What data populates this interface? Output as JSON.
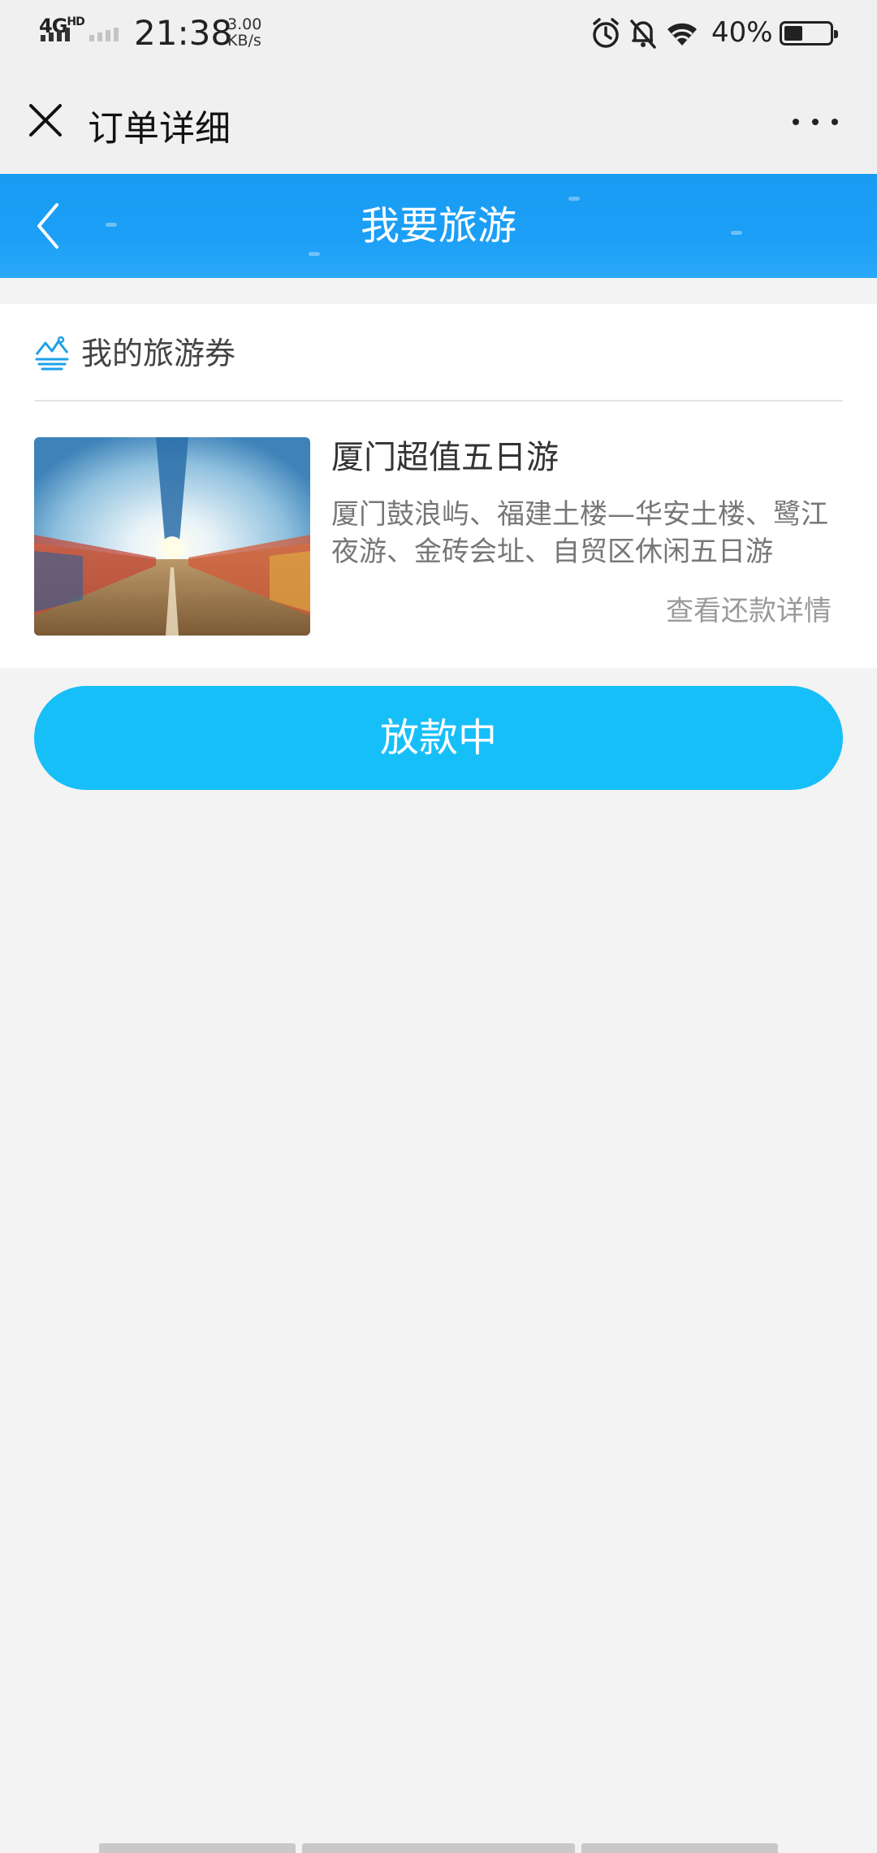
{
  "status_bar": {
    "network_type": "4G",
    "network_sup": "HD",
    "time": "21:38",
    "net_speed_value": "3.00",
    "net_speed_unit": "KB/s",
    "battery_percent": "40%",
    "battery_level": 0.4,
    "icons": [
      "signal-icon",
      "alarm-icon",
      "mute-icon",
      "wifi-icon",
      "battery-icon"
    ]
  },
  "nav_bar": {
    "title": "订单详细",
    "close_icon": "close-icon",
    "more_icon": "more-icon"
  },
  "header": {
    "title": "我要旅游",
    "back_icon": "chevron-left-icon",
    "color": "#1a9cf3"
  },
  "voucher_card": {
    "section_label": "我的旅游券",
    "section_icon": "mountain-icon",
    "product": {
      "title": "厦门超值五日游",
      "description": "厦门鼓浪屿、福建土楼—华安土楼、鹭江夜游、金砖会址、自贸区休闲五日游",
      "detail_link": "查看还款详情"
    }
  },
  "action_button": {
    "label": "放款中",
    "color": "#17bff8"
  }
}
